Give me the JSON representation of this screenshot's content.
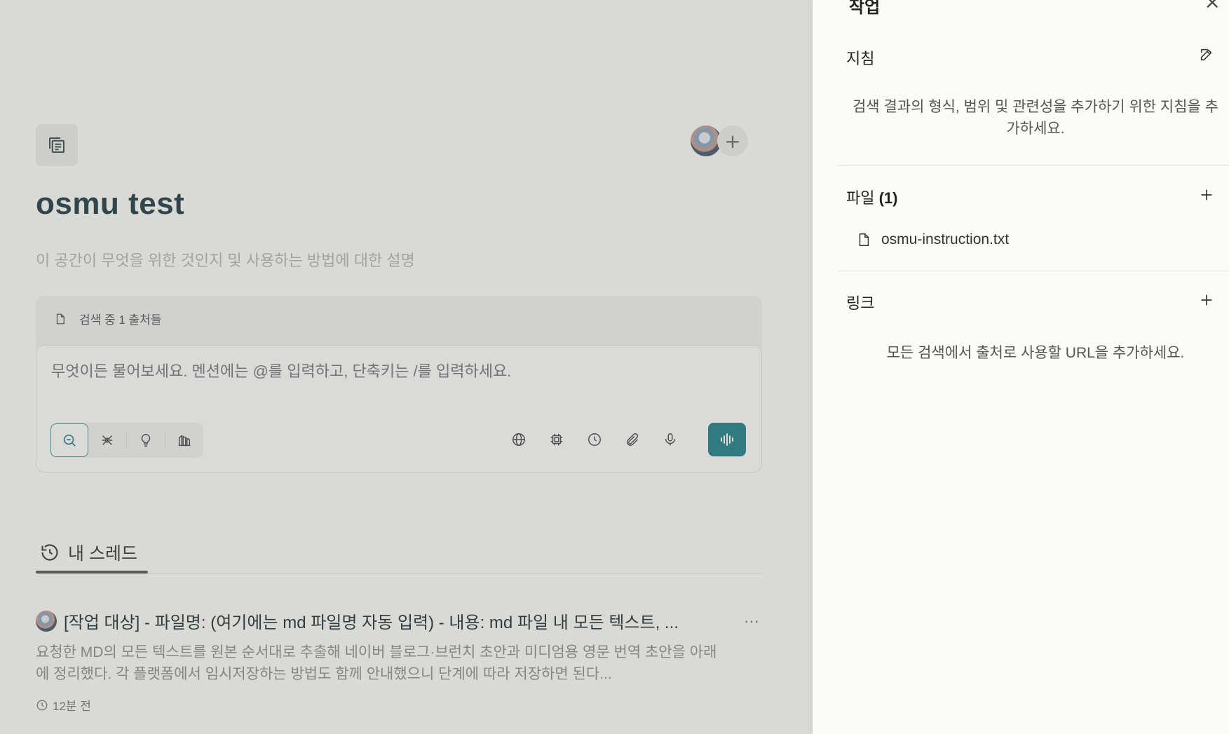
{
  "space": {
    "title": "osmu test",
    "description_placeholder": "이 공간이 무엇을 위한 것인지 및 사용하는 방법에 대한 설명"
  },
  "composer": {
    "sources_label": "검색 중 1 출처들",
    "placeholder": "무엇이든 물어보세요. 멘션에는 @를 입력하고, 단축키는 /를 입력하세요.",
    "modes": [
      "search-icon",
      "research-icon",
      "lightbulb-icon",
      "labs-icon"
    ],
    "tools": [
      "globe-icon",
      "chip-icon",
      "clock-icon",
      "paperclip-icon",
      "microphone-icon"
    ],
    "send_icon": "voice-wave-icon"
  },
  "threads": {
    "tab_label": "내 스레드",
    "items": [
      {
        "title": "[작업 대상] - 파일명: (여기에는 md 파일명 자동 입력) - 내용: md 파일 내 모든 텍스트, ...",
        "snippet": "요청한 MD의 모든 텍스트를 원본 순서대로 추출해 네이버 블로그·브런치 초안과 미디엄용 영문 번역 초안을 아래에 정리했다. 각 플랫폼에서 임시저장하는 방법도 함께 안내했으니 단계에 따라 저장하면 된다...",
        "time": "12분 전",
        "more": "···"
      }
    ]
  },
  "panel": {
    "header": "작업",
    "close_icon": "close-icon",
    "instructions": {
      "title": "지침",
      "hint": "검색 결과의 형식, 범위 및 관련성을 추가하기 위한 지침을 추가하세요."
    },
    "files": {
      "title": "파일",
      "count": "(1)",
      "items": [
        "osmu-instruction.txt"
      ]
    },
    "links": {
      "title": "링크",
      "hint": "모든 검색에서 출처로 사용할 URL을 추가하세요."
    }
  },
  "colors": {
    "accent": "#1e7f86",
    "overlay": "rgba(110,110,110,0.24)"
  }
}
